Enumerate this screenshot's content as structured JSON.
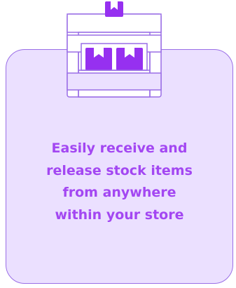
{
  "card": {
    "caption_lines": [
      "Easily receive and",
      "release stock items",
      "from anywhere",
      "within your store"
    ]
  },
  "colors": {
    "card_background": "#ebe0ff",
    "card_border": "#9a6ee6",
    "caption_text": "#a347f2",
    "icon_outline": "#9a6ee6",
    "box_fill": "#9630f0"
  },
  "icon": {
    "name": "shelf-with-boxes-icon"
  }
}
